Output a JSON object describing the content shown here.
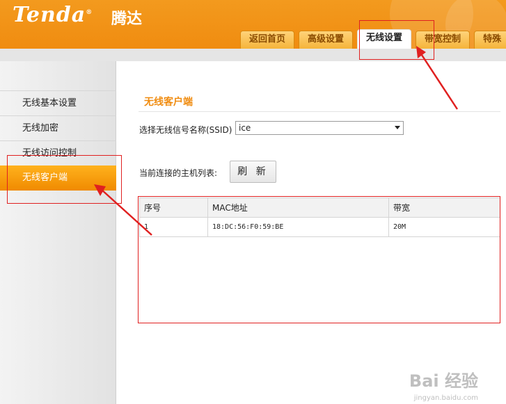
{
  "brand": {
    "logo": "Tenda",
    "logo_reg": "®",
    "name_cn": "腾达"
  },
  "nav": {
    "tabs": [
      {
        "label": "返回首页"
      },
      {
        "label": "高级设置"
      },
      {
        "label": "无线设置",
        "active": true
      },
      {
        "label": "带宽控制"
      },
      {
        "label": "特殊"
      }
    ]
  },
  "sidebar": {
    "items": [
      {
        "label": "无线基本设置"
      },
      {
        "label": "无线加密"
      },
      {
        "label": "无线访问控制"
      },
      {
        "label": "无线客户端",
        "active": true
      }
    ]
  },
  "main": {
    "section_title": "无线客户端",
    "ssid_label": "选择无线信号名称(SSID)",
    "ssid_value": "ice",
    "hosts_label": "当前连接的主机列表:",
    "refresh_label": "刷 新",
    "table": {
      "headers": [
        "序号",
        "MAC地址",
        "带宽"
      ],
      "rows": [
        [
          "1",
          "18:DC:56:F0:59:BE",
          "20M"
        ]
      ]
    }
  },
  "watermark": {
    "main": "Bai 经验",
    "sub": "jingyan.baidu.com"
  },
  "colors": {
    "brand_orange": "#f08c10",
    "annotation_red": "#e02020",
    "active_tab": "#ffffff"
  }
}
